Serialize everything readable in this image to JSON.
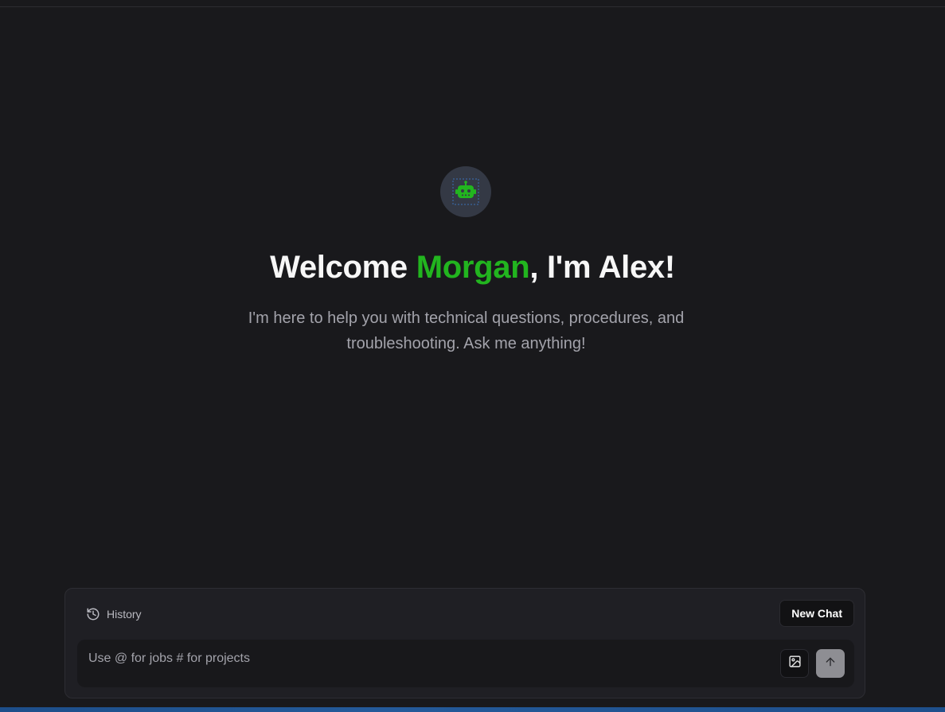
{
  "hero": {
    "avatar_icon": "robot-icon",
    "welcome_prefix": "Welcome ",
    "user_name": "Morgan",
    "welcome_suffix": ", I'm Alex!",
    "subtitle": "I'm here to help you with technical questions, procedures, and troubleshooting. Ask me anything!"
  },
  "composer": {
    "history_label": "History",
    "history_icon": "history-icon",
    "new_chat_label": "New Chat",
    "input_placeholder": "Use @ for jobs # for projects",
    "input_value": "",
    "image_icon": "image-icon",
    "send_icon": "arrow-up-icon"
  },
  "colors": {
    "background": "#19191c",
    "accent": "#22b51f",
    "avatar_bg": "#343945",
    "composer_bg": "#1f1f24",
    "send_button_bg": "#8e8e93"
  }
}
